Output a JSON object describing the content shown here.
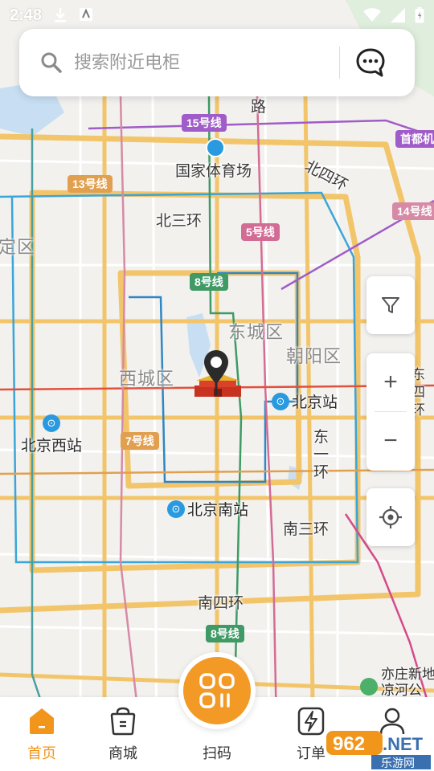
{
  "status_bar": {
    "time": "2:48"
  },
  "search": {
    "placeholder": "搜索附近电柜"
  },
  "map": {
    "road_labels": [
      "路",
      "国家体育场",
      "北四环",
      "北三环",
      "南三环",
      "南四环",
      "东一环"
    ],
    "districts": [
      "定区",
      "东城区",
      "西城区",
      "朝阳区",
      "东四环"
    ],
    "line_badges": [
      {
        "text": "15号线",
        "color": "#a05cc8"
      },
      {
        "text": "13号线",
        "color": "#e0a050"
      },
      {
        "text": "5号线",
        "color": "#d36c95"
      },
      {
        "text": "14号线",
        "color": "#d68aa6"
      },
      {
        "text": "8号线",
        "color": "#3f9a66"
      },
      {
        "text": "7号线",
        "color": "#e0a050"
      },
      {
        "text": "8号线",
        "color": "#3f9a66"
      },
      {
        "text": "首都机",
        "color": "#a05cc8"
      }
    ],
    "stations": [
      "北京站",
      "北京西站",
      "北京南站",
      "亦庄新地",
      "凉河公"
    ]
  },
  "controls": {
    "zoom_in": "+",
    "zoom_out": "−"
  },
  "nav": {
    "items": [
      {
        "label": "首页",
        "icon": "home-icon"
      },
      {
        "label": "商城",
        "icon": "shopping-bag-icon"
      },
      {
        "label": "订单",
        "icon": "order-lightning-icon"
      },
      {
        "label": "",
        "icon": "profile-icon"
      }
    ],
    "scan_label": "扫码"
  },
  "watermark": {
    "text1": "962",
    "text2": ".NET",
    "text3": "乐游网"
  },
  "colors": {
    "accent": "#f2951b",
    "ring_road": "#f3c56a",
    "metro_blue": "#3aa5d8"
  }
}
